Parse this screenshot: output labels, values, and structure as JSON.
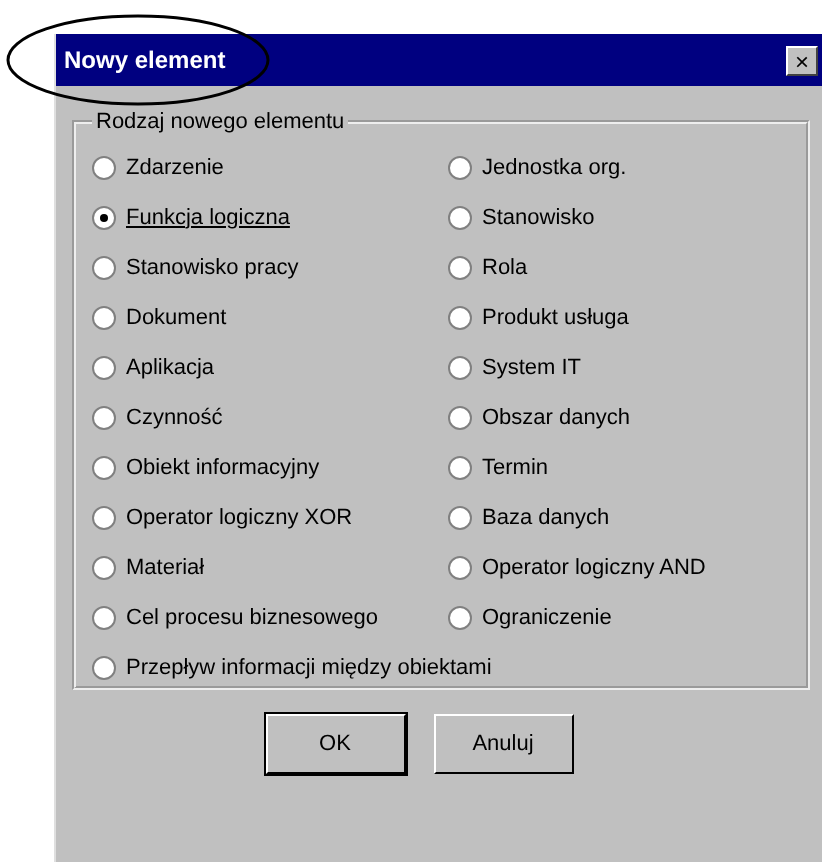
{
  "window": {
    "title": "Nowy element",
    "close": "×"
  },
  "group": {
    "label": "Rodzaj nowego elementu",
    "columns": [
      [
        {
          "label": "Zdarzenie",
          "selected": false
        },
        {
          "label": "Funkcja logiczna",
          "selected": true
        },
        {
          "label": "Stanowisko pracy",
          "selected": false
        },
        {
          "label": "Dokument",
          "selected": false
        },
        {
          "label": "Aplikacja",
          "selected": false
        },
        {
          "label": "Czynność",
          "selected": false
        },
        {
          "label": "Obiekt informacyjny",
          "selected": false
        },
        {
          "label": "Operator logiczny XOR",
          "selected": false
        },
        {
          "label": "Materiał",
          "selected": false
        },
        {
          "label": "Cel procesu biznesowego",
          "selected": false
        },
        {
          "label": "Przepływ informacji między obiektami",
          "selected": false
        }
      ],
      [
        {
          "label": "Jednostka org.",
          "selected": false
        },
        {
          "label": "Stanowisko",
          "selected": false
        },
        {
          "label": "Rola",
          "selected": false
        },
        {
          "label": "Produkt usługa",
          "selected": false
        },
        {
          "label": "System IT",
          "selected": false
        },
        {
          "label": "Obszar danych",
          "selected": false
        },
        {
          "label": "Termin",
          "selected": false
        },
        {
          "label": "Baza danych",
          "selected": false
        },
        {
          "label": "Operator logiczny AND",
          "selected": false
        },
        {
          "label": "Ograniczenie",
          "selected": false
        }
      ]
    ]
  },
  "buttons": [
    {
      "label": "OK",
      "default": true
    },
    {
      "label": "Anuluj",
      "default": false
    }
  ]
}
